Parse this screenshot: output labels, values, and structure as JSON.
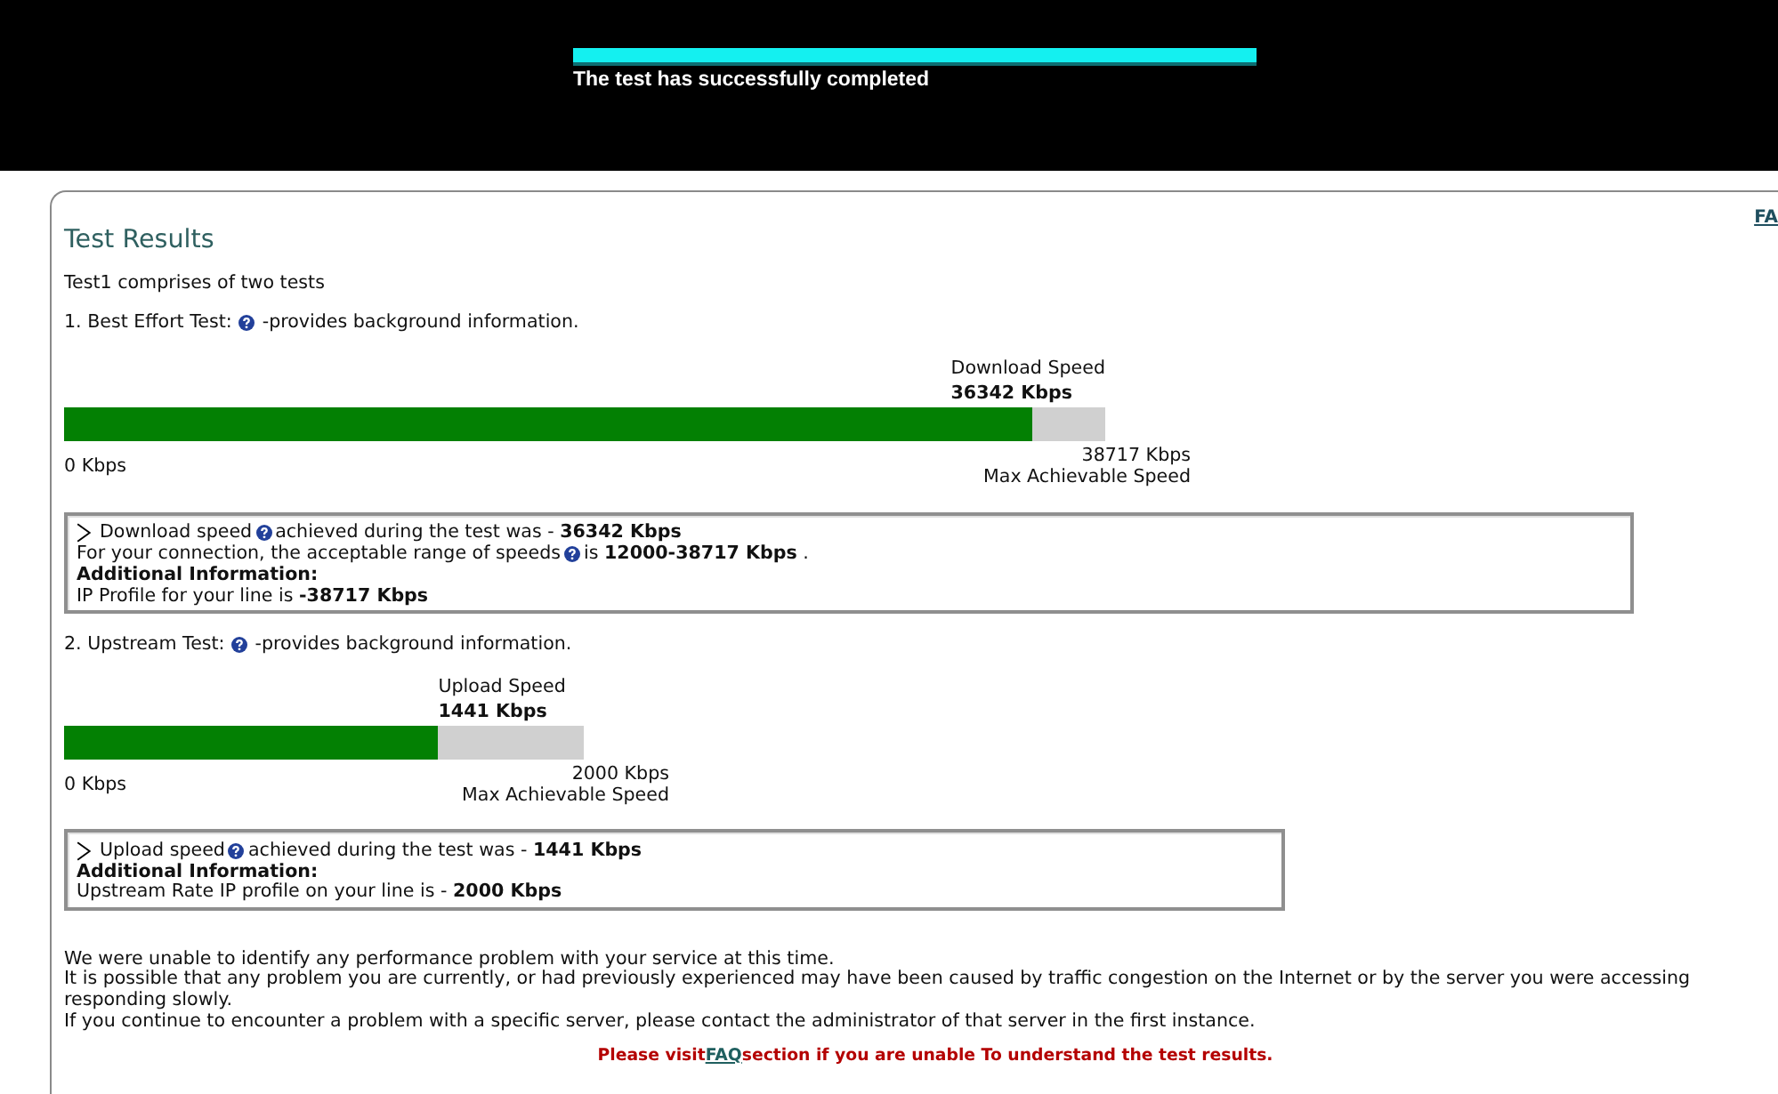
{
  "banner": {
    "progress": {
      "level": 1
    },
    "message": "The test has successfully completed"
  },
  "faq_link": "FA",
  "title": "Test Results",
  "intro": "Test1 comprises of two tests",
  "tests": [
    {
      "heading": "1. Best Effort Test:",
      "help_text": "-provides background information.",
      "gauge": {
        "label": "Download Speed",
        "value": "36342 Kbps",
        "level": 0.93,
        "min": "0 Kbps",
        "max": "38717 Kbps",
        "max_label": "Max Achievable Speed"
      },
      "details": [
        {
          "kind": "result",
          "lead": "Download speed",
          "text": "achieved during the test was - **36342 Kbps**"
        },
        {
          "kind": "help",
          "lead": "For your connection, the acceptable range of speeds",
          "text": "is **12000-38717 Kbps** ."
        },
        {
          "kind": "heading",
          "text": "Additional Information:"
        },
        {
          "kind": "plain",
          "text": "IP Profile for your line is **-38717 Kbps**"
        }
      ]
    },
    {
      "heading": "2. Upstream Test:",
      "help_text": "-provides background information.",
      "gauge": {
        "label": "Upload Speed",
        "value": "1441 Kbps",
        "level": 0.72,
        "min": "0 Kbps",
        "max": "2000 Kbps",
        "max_label": "Max Achievable Speed"
      },
      "details": [
        {
          "kind": "result",
          "lead": "Upload speed",
          "text": "achieved during the test was - **1441 Kbps**"
        },
        {
          "kind": "heading",
          "text": "Additional Information:"
        },
        {
          "kind": "plain",
          "text": "Upstream Rate IP profile on your line is - **2000 Kbps**"
        }
      ]
    }
  ],
  "summary": [
    "We were unable to identify any performance problem with your service at this time.",
    "It is possible that any problem you are currently, or had previously experienced may have been caused by traffic congestion on the Internet or by the server you were accessing responding slowly.",
    "If you continue to encounter a problem with a specific server, please contact the administrator of that server in the first instance."
  ],
  "notice": {
    "before": "Please visit",
    "link": "FAQ",
    "after": "section if you are unable To understand the test results."
  }
}
